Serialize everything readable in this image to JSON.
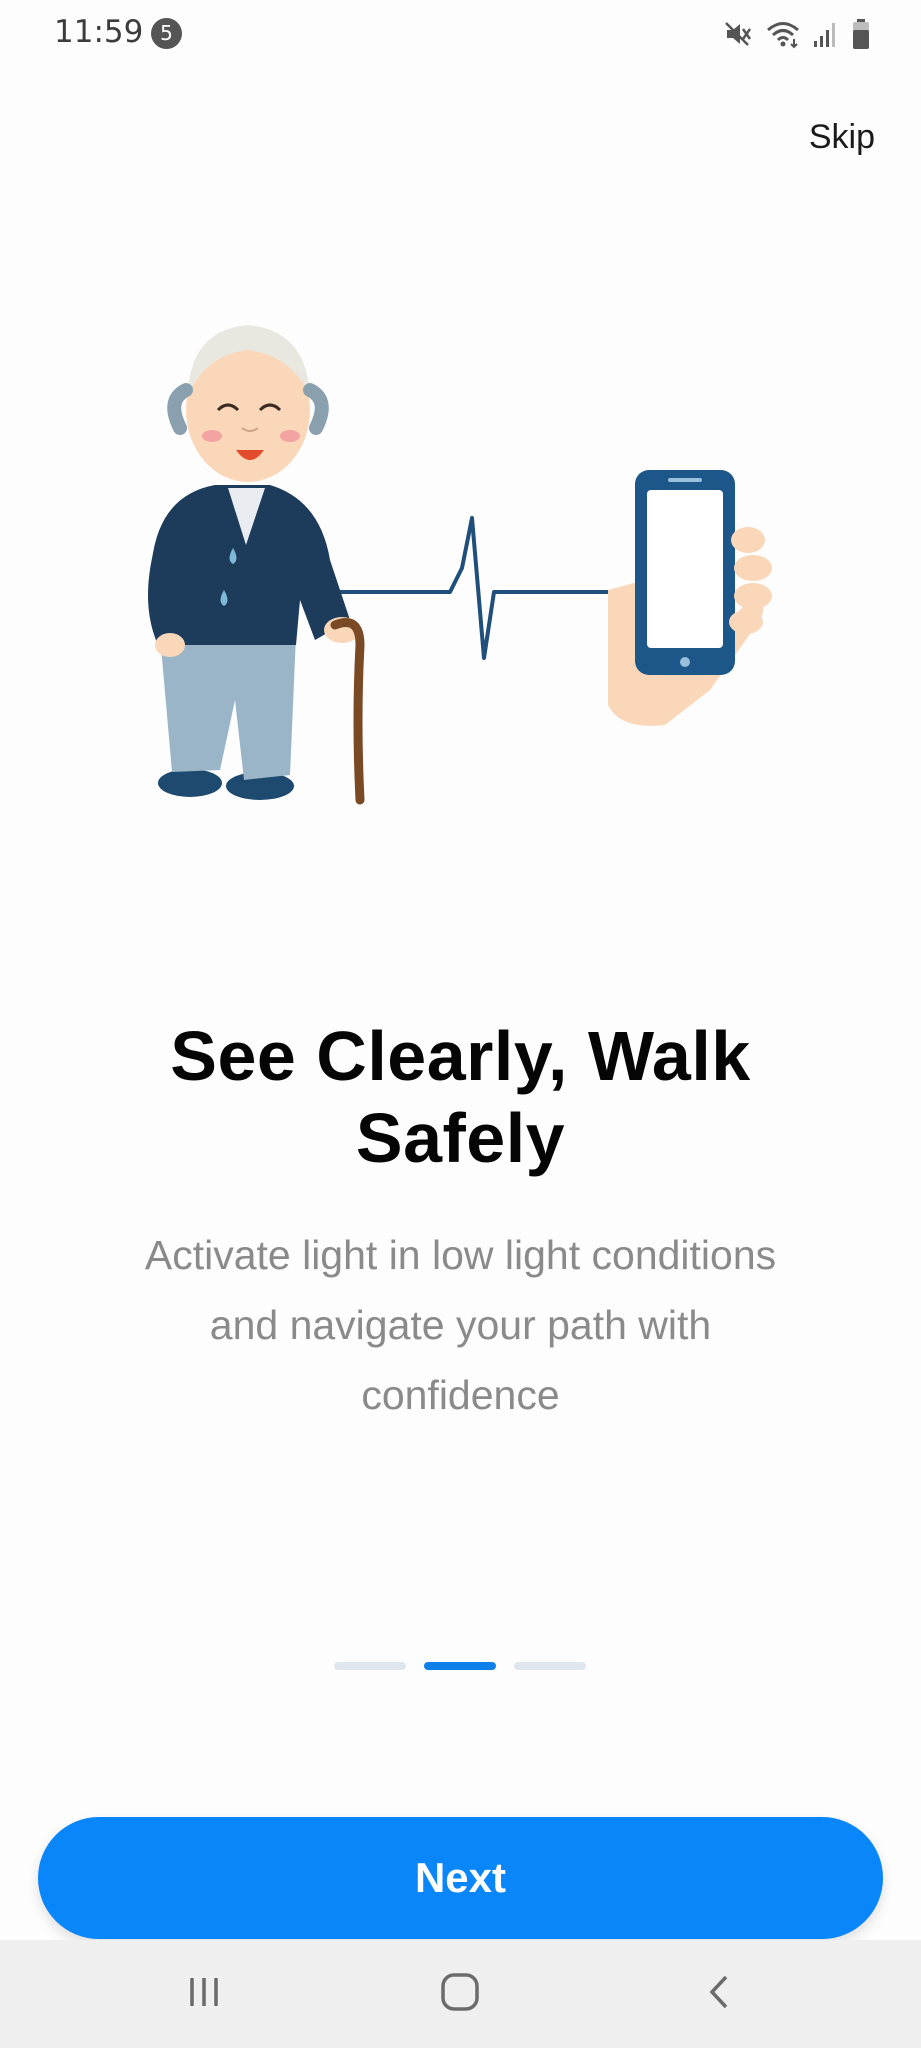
{
  "status_bar": {
    "time": "11:59",
    "notification_count": "5",
    "icons": [
      "mute-icon",
      "wifi-icon",
      "signal-icon",
      "battery-icon"
    ]
  },
  "skip_label": "Skip",
  "hero": {
    "illustration": "elderly-man-heartbeat-phone",
    "colors": {
      "jacket": "#1d3b5a",
      "pants": "#9ab5c8",
      "cane": "#7a4a24",
      "line": "#1f4f7a",
      "phone": "#1d5689",
      "skin": "#fad7b8"
    }
  },
  "onboarding": {
    "title": "See Clearly, Walk Safely",
    "subtitle": "Activate light in low light conditions and navigate your path with confidence",
    "page_index": 2,
    "page_count": 3
  },
  "next_label": "Next",
  "colors": {
    "accent": "#0a86fb",
    "pager_active": "#0c7fe8",
    "pager_inactive": "#dfe6ee"
  },
  "nav_bar": {
    "icons": [
      "recents-icon",
      "home-icon",
      "back-icon"
    ]
  }
}
